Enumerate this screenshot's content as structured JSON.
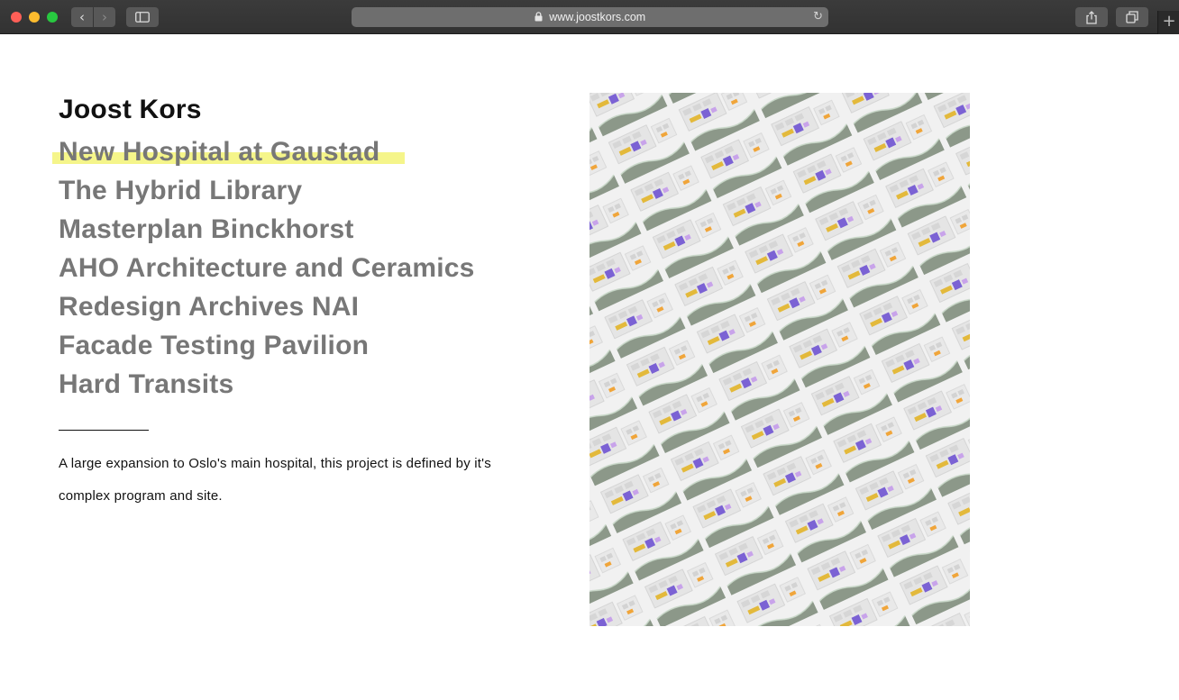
{
  "browser": {
    "url": "www.joostkors.com"
  },
  "site": {
    "title": "Joost Kors"
  },
  "projects": [
    {
      "label": "New Hospital at Gaustad",
      "active": true
    },
    {
      "label": "The Hybrid Library",
      "active": false
    },
    {
      "label": "Masterplan Binckhorst",
      "active": false
    },
    {
      "label": "AHO Architecture and Ceramics",
      "active": false
    },
    {
      "label": "Redesign Archives NAI",
      "active": false
    },
    {
      "label": "Facade Testing Pavilion",
      "active": false
    },
    {
      "label": "Hard Transits",
      "active": false
    }
  ],
  "description": "A large expansion to Oslo's main hospital, this project is defined by it's complex program and site.",
  "colors": {
    "highlight": "#f5f58a",
    "project_text": "#777777",
    "title_text": "#111111"
  },
  "icons": {
    "back": "chevron-left-icon",
    "forward": "chevron-right-icon",
    "sidebar": "sidebar-icon",
    "lock": "lock-icon",
    "reload": "reload-icon",
    "share": "share-icon",
    "tabs": "tabs-icon",
    "new_tab": "plus-icon"
  }
}
